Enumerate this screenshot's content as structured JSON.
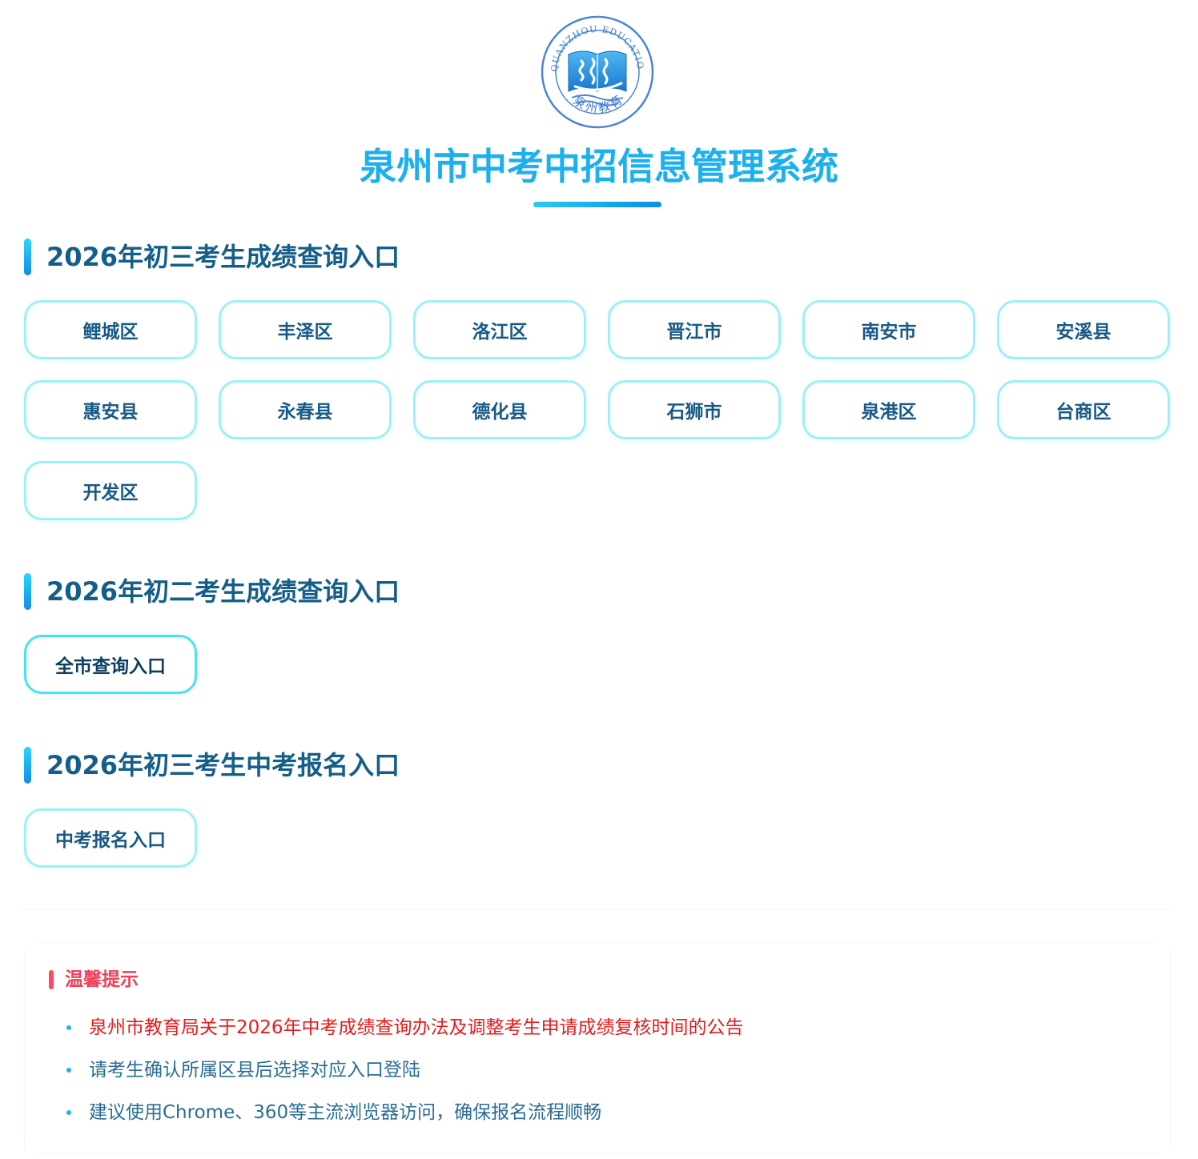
{
  "logo": {
    "arc_text_top": "QUANZHOU   EDUCATION",
    "arc_text_bottom": "泉州教育",
    "colors": {
      "ring": "#3b7fd1",
      "book": "#2c8ee0"
    }
  },
  "header": {
    "title": "泉州市中考中招信息管理系统"
  },
  "sections": [
    {
      "title": "2026年初三考生成绩查询入口",
      "buttons": [
        "鲤城区",
        "丰泽区",
        "洛江区",
        "晋江市",
        "南安市",
        "安溪县",
        "惠安县",
        "永春县",
        "德化县",
        "石狮市",
        "泉港区",
        "台商区",
        "开发区"
      ]
    },
    {
      "title": "2026年初二考生成绩查询入口",
      "buttons": [
        "全市查询入口"
      ]
    },
    {
      "title": "2026年初三考生中考报名入口",
      "buttons": [
        "中考报名入口"
      ]
    }
  ],
  "tips": {
    "title": "温馨提示",
    "items": [
      "泉州市教育局关于2026年中考成绩查询办法及调整考生申请成绩复核时间的公告",
      "请考生确认所属区县后选择对应入口登陆",
      "建议使用Chrome、360等主流浏览器访问，确保报名流程顺畅"
    ]
  },
  "colors": {
    "title": "#1cb0ee",
    "section_title": "#145e8a",
    "button_border": "#9cf0f7",
    "tip_alert": "#e51c1c",
    "tips_heading": "#f0405a"
  }
}
